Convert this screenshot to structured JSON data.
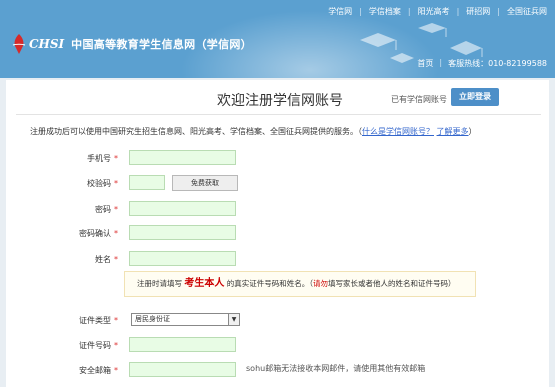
{
  "topnav": [
    "学信网",
    "学信档案",
    "阳光高考",
    "研招网",
    "全国征兵网"
  ],
  "logo": {
    "mark": "CHSI",
    "name": "中国高等教育学生信息网（学信网）"
  },
  "subnav": {
    "home": "首页",
    "hotline": "客服热线：010-82199588"
  },
  "page": {
    "title": "欢迎注册学信网账号",
    "has_account": "已有学信网账号",
    "login_button": "立即登录",
    "intro_text": "注册成功后可以使用中国研究生招生信息网、阳光高考、学信档案、全国征兵网提供的服务。（",
    "intro_link1": "什么是学信网账号？",
    "intro_link2": "了解更多",
    "intro_close": "）"
  },
  "form": {
    "phone_label": "手机号",
    "code_label": "校验码",
    "get_code_button": "免费获取",
    "password_label": "密码",
    "confirm_label": "密码确认",
    "name_label": "姓名",
    "tip_before": "注册时请填写",
    "tip_big": "考生本人",
    "tip_mid": "的真实证件号码和姓名。（",
    "tip_red": "请勿",
    "tip_after": "填写家长或者他人的姓名和证件号码）",
    "id_type_label": "证件类型",
    "id_type_value": "居民身份证",
    "id_number_label": "证件号码",
    "email_label": "安全邮箱",
    "email_note": "sohu邮箱无法接收本网邮件，请使用其他有效邮箱",
    "required_mark": "*"
  },
  "colors": {
    "header": "#5ba0d0",
    "accent": "#4d8fc8",
    "field_fill": "#e8fce5",
    "required": "#d33333"
  }
}
